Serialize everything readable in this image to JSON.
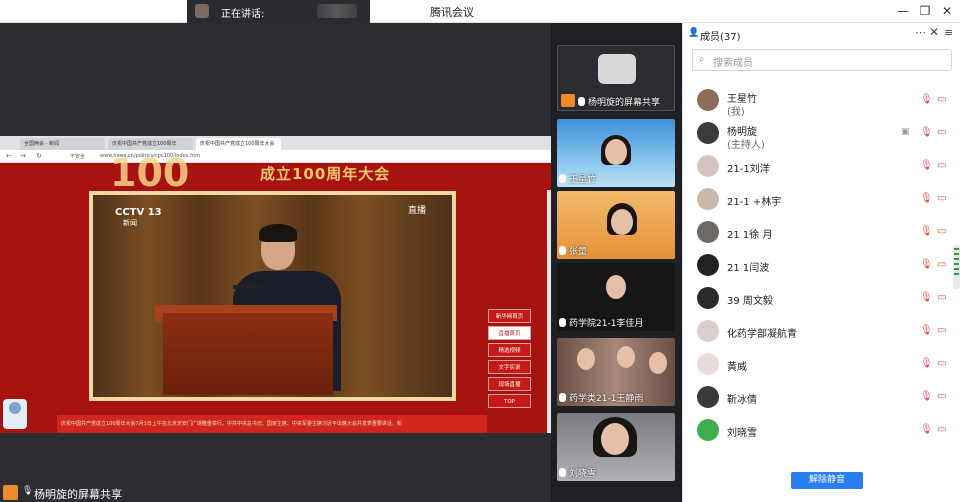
{
  "window": {
    "title": "腾讯会议",
    "speaking_label": "正在讲话:"
  },
  "browser": {
    "tabs": [
      "全国两会 - 新闻",
      "庆祝中国共产党成立100周年",
      "庆祝中国共产党成立100周年大会"
    ],
    "url": "www.news.cn/politics/cpc100/index.htm",
    "not_secure": "不安全"
  },
  "webpage": {
    "banner": "成立100周年大会",
    "big_number": "100",
    "cctv": "CCTV 13",
    "cctv_sub": "新闻",
    "live": "直播",
    "menu": [
      "新华网首页",
      "直播首页",
      "精选视频",
      "文字实录",
      "现场直播",
      "TOP"
    ],
    "strip_text": "庆祝中国共产党成立100周年大会7月1日上午在北京天安门广场隆重举行。中共中央总书记、国家主席、中央军委主席习近平出席大会并发表重要讲话。新"
  },
  "share_bar": {
    "label": "杨明旋的屏幕共享"
  },
  "tiles": [
    {
      "name": "杨明旋的屏幕共享"
    },
    {
      "name": "王星竹"
    },
    {
      "name": "张童"
    },
    {
      "name": "药学院21-1李佳月"
    },
    {
      "name": "药学类21-1王静雨"
    },
    {
      "name": "刘晓雪"
    }
  ],
  "panel": {
    "title": "成员(37)",
    "search_placeholder": "搜索成员",
    "unmute_button": "解除静音"
  },
  "members": [
    {
      "name": "王星竹",
      "role": "(我)"
    },
    {
      "name": "杨明旋",
      "role": "(主持人)"
    },
    {
      "name": "21-1刘洋",
      "role": ""
    },
    {
      "name": "21-1 +林宇",
      "role": ""
    },
    {
      "name": "21 1徐 月",
      "role": ""
    },
    {
      "name": "21 1闫波",
      "role": ""
    },
    {
      "name": "39 周文毅",
      "role": ""
    },
    {
      "name": "化药学部凝航青",
      "role": ""
    },
    {
      "name": "黄威",
      "role": ""
    },
    {
      "name": "靳冰倩",
      "role": ""
    },
    {
      "name": "刘晓雪",
      "role": ""
    }
  ],
  "colors": {
    "accent": "#2a7ff0",
    "muted": "#e04b4b",
    "share_badge": "#ef8a2a",
    "page_red": "#a7130f"
  }
}
